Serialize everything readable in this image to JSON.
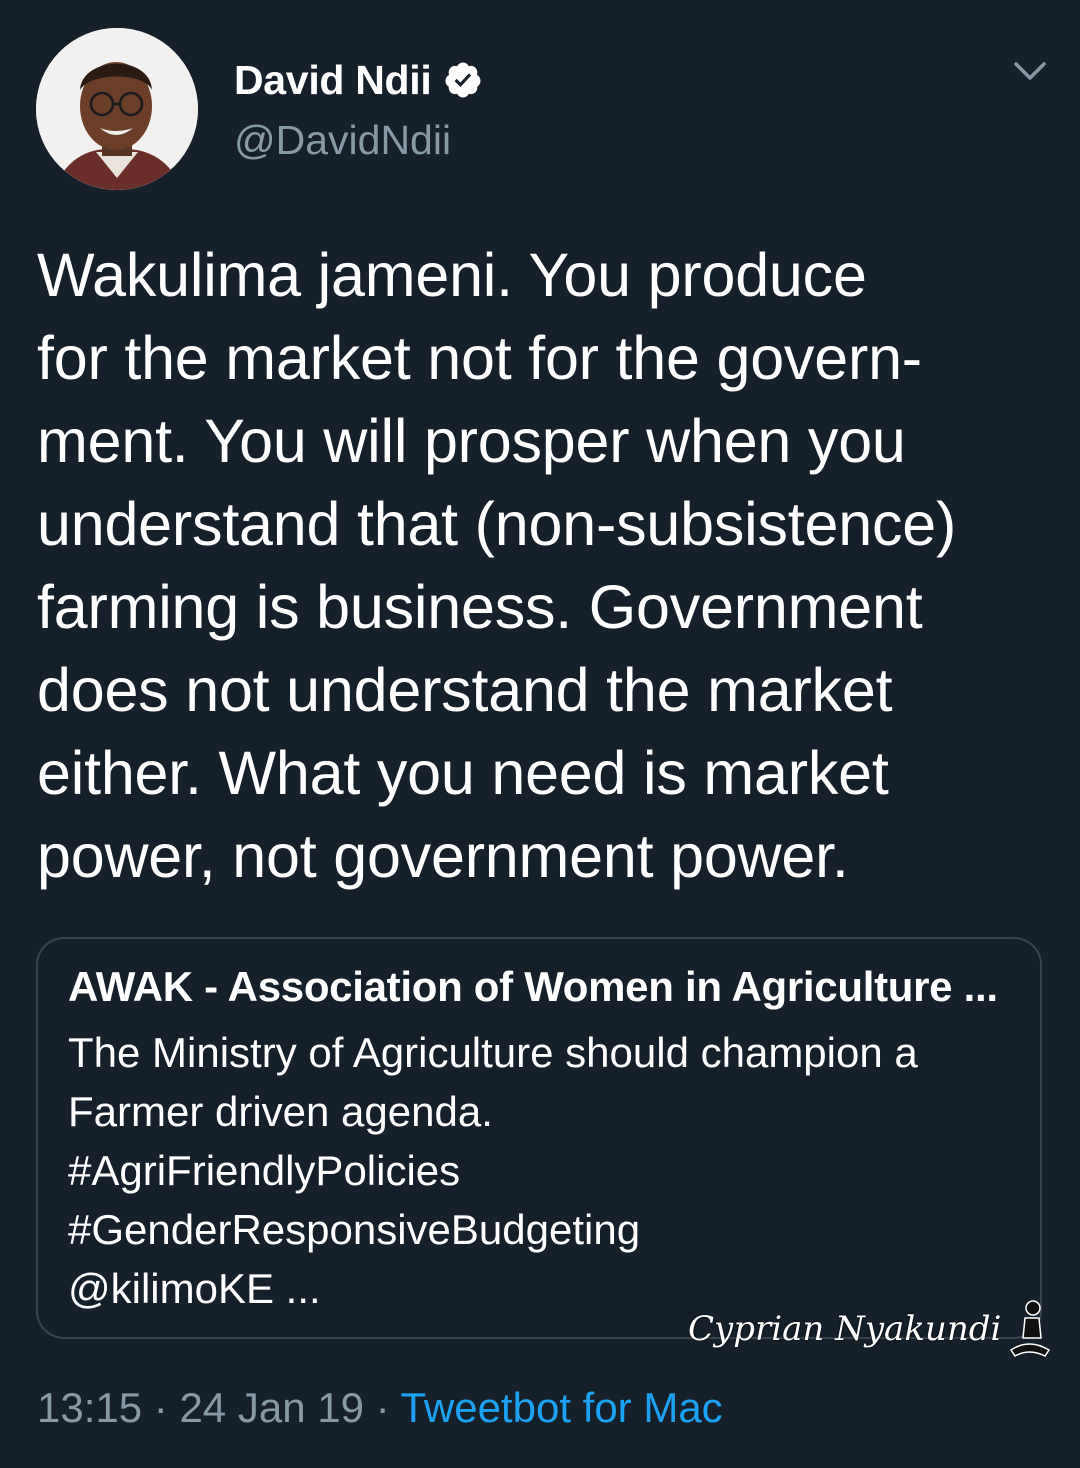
{
  "tweet": {
    "display_name": "David Ndii",
    "handle": "@DavidNdii",
    "verified": true,
    "text": "Wakulima jameni. You produce\nfor the market not for the govern-\nment.   You will prosper when you\nunderstand that (non-subsistence)\nfarming is business.  Government\ndoes not understand the market\neither. What you need is market\npower, not government power.",
    "time": "13:15",
    "separator": "·",
    "date": "24 Jan 19",
    "source": "Tweetbot for Mac"
  },
  "quoted_tweet": {
    "author": "AWAK - Association of Women in Agriculture ...",
    "text": "The Ministry of Agriculture should champion a\nFarmer driven agenda.\n#AgriFriendlyPolicies\n#GenderResponsiveBudgeting\n@kilimoKE ..."
  },
  "watermark": {
    "text": "Cyprian Nyakundi"
  },
  "icons": {
    "verified": "verified-badge-icon",
    "menu": "chevron-down-icon"
  },
  "colors": {
    "background": "#15202b",
    "text": "#ffffff",
    "secondary": "#8899a6",
    "link": "#1da1f2",
    "border": "#38444d"
  }
}
